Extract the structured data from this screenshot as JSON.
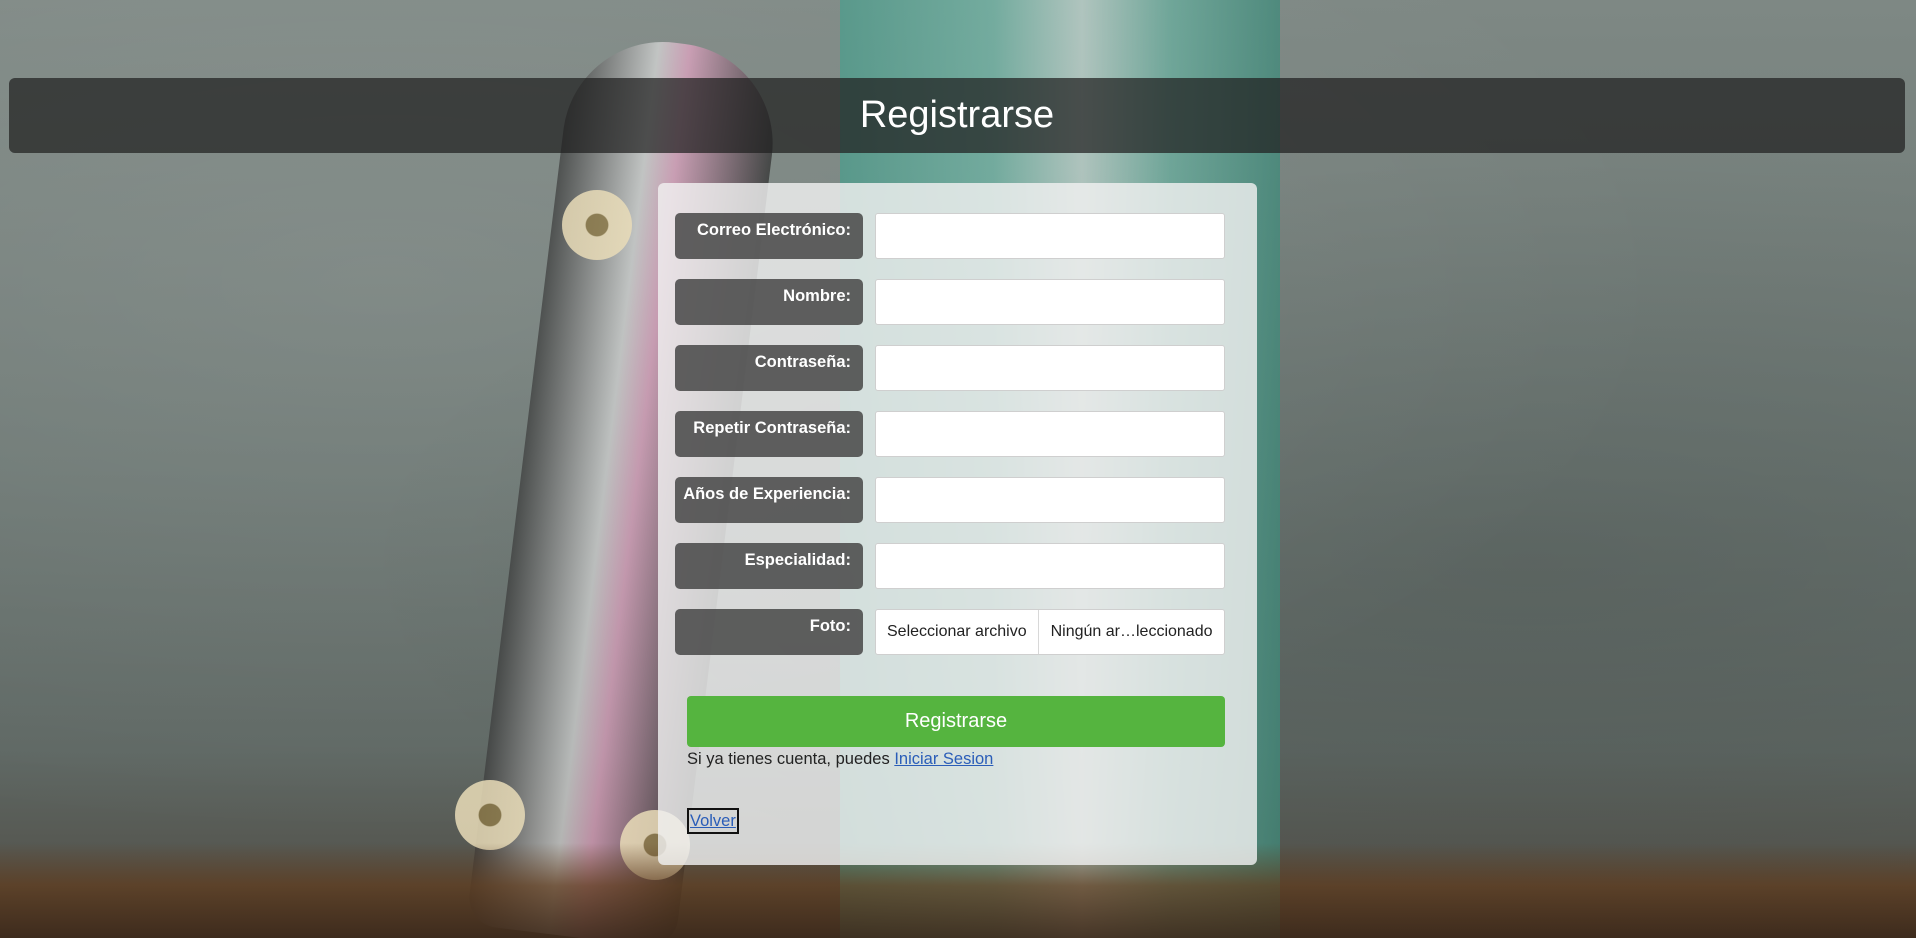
{
  "header": {
    "title": "Registrarse"
  },
  "form": {
    "fields": [
      {
        "label": "Correo Electrónico:",
        "value": ""
      },
      {
        "label": "Nombre:",
        "value": ""
      },
      {
        "label": "Contraseña:",
        "value": ""
      },
      {
        "label": "Repetir Contraseña:",
        "value": ""
      },
      {
        "label": "Años de Experiencia:",
        "value": ""
      },
      {
        "label": "Especialidad:",
        "value": ""
      }
    ],
    "photo": {
      "label": "Foto:",
      "button": "Seleccionar archivo",
      "status": "Ningún ar…leccionado"
    },
    "submit_label": "Registrarse",
    "login_prompt": "Si ya tienes cuenta, puedes ",
    "login_link": "Iniciar Sesion",
    "back_link": "Volver"
  },
  "colors": {
    "submit": "#55b43f",
    "header_bg": "#202020",
    "link": "#2a5db8"
  }
}
